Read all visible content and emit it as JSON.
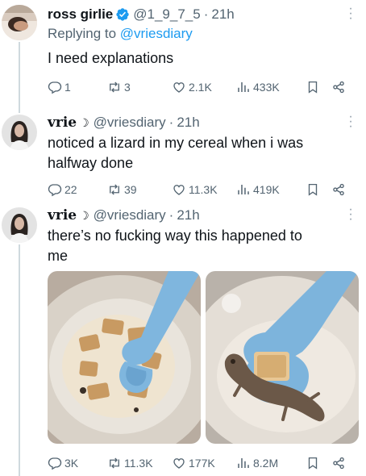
{
  "tweets": [
    {
      "name": "ross girlie",
      "handle": "@1_9_7_5",
      "time": "21h",
      "replying_prefix": "Replying to",
      "replying_to": "@vriesdiary",
      "text": "I need explanations",
      "stats": {
        "replies": "1",
        "retweets": "3",
        "likes": "2.1K",
        "views": "433K"
      }
    },
    {
      "name": "vrie",
      "handle": "@vriesdiary",
      "time": "21h",
      "text": "noticed a lizard in my cereal when i was\nhalfway done",
      "stats": {
        "replies": "22",
        "retweets": "39",
        "likes": "11.3K",
        "views": "419K"
      }
    },
    {
      "name": "vrie",
      "handle": "@vriesdiary",
      "time": "21h",
      "text": "there’s no fucking way this happened to\nme",
      "stats": {
        "replies": "3K",
        "retweets": "11.3K",
        "likes": "177K",
        "views": "8.2M"
      }
    }
  ],
  "colors": {
    "accent": "#1d9bf0",
    "muted": "#536471",
    "thread_line": "#cfd9de"
  },
  "icons": [
    "verified-badge-icon",
    "moon-icon",
    "more-icon",
    "reply-icon",
    "retweet-icon",
    "like-icon",
    "views-icon",
    "bookmark-icon",
    "share-icon"
  ]
}
